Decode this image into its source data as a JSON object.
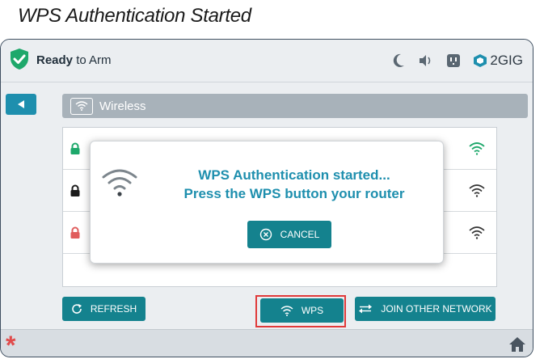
{
  "heading": "WPS Authentication Started",
  "status": {
    "bold": "Ready",
    "rest": " to Arm",
    "brand": "2GIG",
    "shield_color": "#1ea86b"
  },
  "icons": [
    "shield-check-icon",
    "moon-icon",
    "volume-icon",
    "outlet-icon",
    "2gig-logo-icon",
    "back-arrow-icon",
    "wifi-icon",
    "lock-icon",
    "cancel-x-icon",
    "refresh-icon",
    "swap-arrows-icon",
    "asterisk-icon",
    "home-icon"
  ],
  "page": {
    "title": "Wireless"
  },
  "networks": [
    {
      "lock_color": "#1ea86b",
      "signal_color": "#1ea86b"
    },
    {
      "lock_color": "#1b1b1b",
      "signal_color": "#333333"
    },
    {
      "lock_color": "#e05d5d",
      "signal_color": "#333333"
    }
  ],
  "dialog": {
    "line1": "WPS Authentication started...",
    "line2": "Press the WPS button your router",
    "cancel_label": "CANCEL"
  },
  "buttons": {
    "refresh": "REFRESH",
    "wps": "WPS",
    "join": "JOIN OTHER NETWORK"
  },
  "colors": {
    "accent": "#14828e",
    "dialog_text": "#1e8fae",
    "highlight": "#e03a3a"
  }
}
